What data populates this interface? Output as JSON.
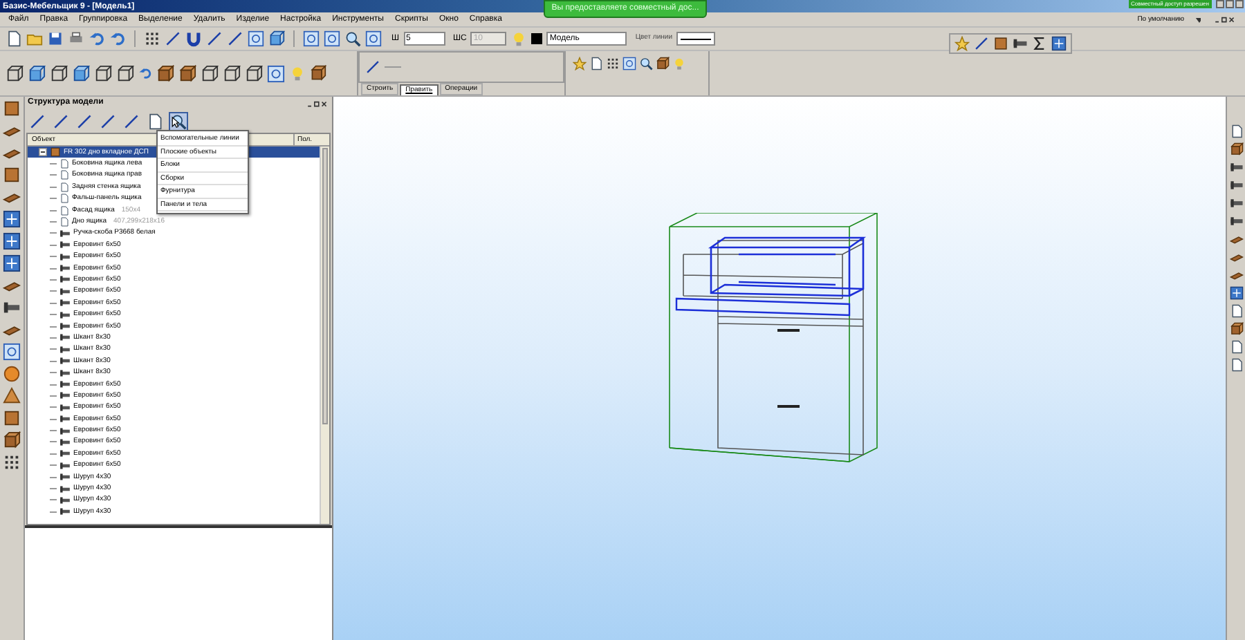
{
  "window": {
    "title": "Базис-Мебельщик 9 - [Модель1]"
  },
  "share_notice": "Вы предоставляете совместный дос...",
  "share_badge": "Совместный доступ разрешен",
  "menu": [
    "Файл",
    "Правка",
    "Группировка",
    "Выделение",
    "Удалить",
    "Изделие",
    "Настройка",
    "Инструменты",
    "Скрипты",
    "Окно",
    "Справка"
  ],
  "workspace_preset": "По умолчанию",
  "toolbar": {
    "width_label": "Ш",
    "width_value": "5",
    "ws_label": "ШС",
    "ws_value": "10",
    "ws_disabled": true,
    "layer": "Модель",
    "line_color_label": "Цвет линии"
  },
  "tabs": [
    {
      "label": "Строить",
      "selected": false
    },
    {
      "label": "Править",
      "selected": true
    },
    {
      "label": "Операции",
      "selected": false
    }
  ],
  "panel": {
    "title": "Структура модели",
    "columns": [
      "Объект",
      "Пол."
    ]
  },
  "tree": [
    {
      "label": "FR 302 дно вкладное ДСП",
      "kind": "assembly",
      "selected": true,
      "expanded": true,
      "children": [
        {
          "label": "Боковина ящика лева",
          "kind": "panel",
          "selected": false
        },
        {
          "label": "Боковина ящика прав",
          "kind": "panel",
          "selected": false
        },
        {
          "label": "Задняя стенка ящика",
          "kind": "panel",
          "selected": false
        },
        {
          "label": "Фальш-панель ящика",
          "kind": "panel",
          "selected": false
        },
        {
          "label": "Фасад ящика",
          "detail": "150x4",
          "kind": "panel",
          "selected": false
        },
        {
          "label": "Дно ящика",
          "detail": "407,299x218x16",
          "kind": "panel",
          "selected": false
        },
        {
          "label": "Ручка-скоба Р3668 белая",
          "kind": "hardware",
          "selected": false
        },
        {
          "label": "Евровинт 6x50",
          "kind": "hardware",
          "selected": false
        },
        {
          "label": "Евровинт 6x50",
          "kind": "hardware",
          "selected": false
        },
        {
          "label": "Евровинт 6x50",
          "kind": "hardware",
          "selected": false
        },
        {
          "label": "Евровинт 6x50",
          "kind": "hardware",
          "selected": false
        },
        {
          "label": "Евровинт 6x50",
          "kind": "hardware",
          "selected": false
        },
        {
          "label": "Евровинт 6x50",
          "kind": "hardware",
          "selected": false
        },
        {
          "label": "Евровинт 6x50",
          "kind": "hardware",
          "selected": false
        },
        {
          "label": "Евровинт 6x50",
          "kind": "hardware",
          "selected": false
        },
        {
          "label": "Шкант 8x30",
          "kind": "hardware",
          "selected": false
        },
        {
          "label": "Шкант 8x30",
          "kind": "hardware",
          "selected": false
        },
        {
          "label": "Шкант 8x30",
          "kind": "hardware",
          "selected": false
        },
        {
          "label": "Шкант 8x30",
          "kind": "hardware",
          "selected": false
        },
        {
          "label": "Евровинт 6x50",
          "kind": "hardware",
          "selected": false
        },
        {
          "label": "Евровинт 6x50",
          "kind": "hardware",
          "selected": false
        },
        {
          "label": "Евровинт 6x50",
          "kind": "hardware",
          "selected": false
        },
        {
          "label": "Евровинт 6x50",
          "kind": "hardware",
          "selected": false
        },
        {
          "label": "Евровинт 6x50",
          "kind": "hardware",
          "selected": false
        },
        {
          "label": "Евровинт 6x50",
          "kind": "hardware",
          "selected": false
        },
        {
          "label": "Евровинт 6x50",
          "kind": "hardware",
          "selected": false
        },
        {
          "label": "Евровинт 6x50",
          "kind": "hardware",
          "selected": false
        },
        {
          "label": "Шуруп 4x30",
          "kind": "hardware",
          "selected": false
        },
        {
          "label": "Шуруп 4x30",
          "kind": "hardware",
          "selected": false
        },
        {
          "label": "Шуруп 4x30",
          "kind": "hardware",
          "selected": false
        },
        {
          "label": "Шуруп 4x30",
          "kind": "hardware",
          "selected": false
        }
      ]
    }
  ],
  "filter_menu": [
    "Вспомогательные линии",
    "Плоские объекты",
    "Блоки",
    "Сборки",
    "Фурнитура",
    "Панели и тела"
  ]
}
